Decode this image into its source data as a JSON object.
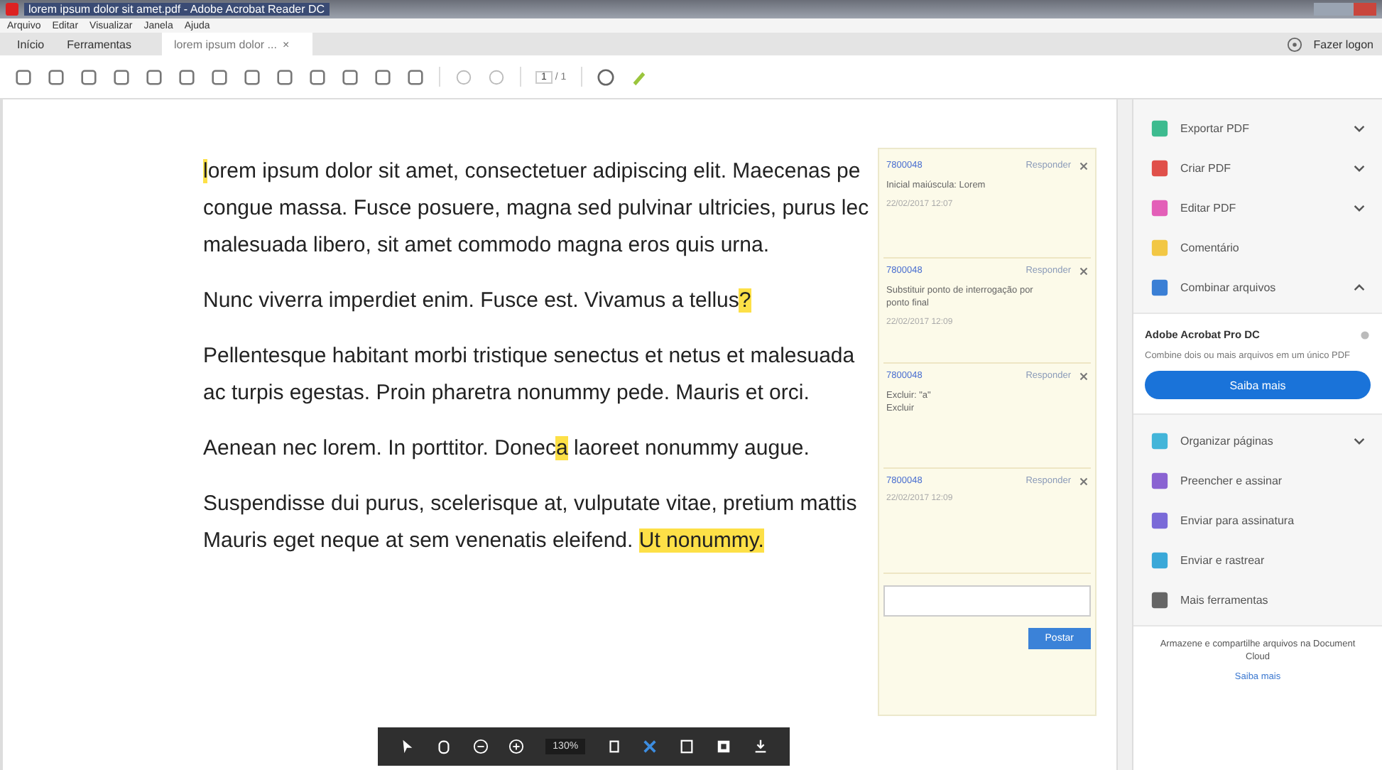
{
  "window": {
    "title": "lorem ipsum dolor sit amet.pdf - Adobe Acrobat Reader DC"
  },
  "menu": [
    "Arquivo",
    "Editar",
    "Visualizar",
    "Janela",
    "Ajuda"
  ],
  "tabs": [
    {
      "label": "Início",
      "selected": false
    },
    {
      "label": "Ferramentas",
      "selected": false
    },
    {
      "label": "lorem ipsum dolor ...",
      "selected": true
    }
  ],
  "tab_close": "×",
  "sign_in": "Fazer logon",
  "toolbar": {
    "page": "1",
    "pages": "/ 1"
  },
  "document": {
    "paragraphs": [
      [
        [
          {
            "text": "l",
            "highlight": true
          },
          {
            "text": "orem ipsum dolor sit amet, consectetuer adipiscing elit. Maecenas pe",
            "highlight": false
          }
        ],
        [
          {
            "text": "congue massa. Fusce posuere, magna sed pulvinar ultricies, purus lec",
            "highlight": false
          }
        ],
        [
          {
            "text": "malesuada libero, sit amet commodo magna eros quis urna.",
            "highlight": false
          }
        ]
      ],
      [
        [
          {
            "text": "Nunc viverra imperdiet enim. Fusce est. Vivamus a tellus",
            "highlight": false
          },
          {
            "text": "?",
            "highlight": true
          }
        ]
      ],
      [
        [
          {
            "text": "Pellentesque habitant morbi tristique senectus et netus et malesuada",
            "highlight": false
          }
        ],
        [
          {
            "text": "ac turpis egestas. Proin pharetra nonummy pede. Mauris et orci.",
            "highlight": false
          }
        ]
      ],
      [
        [
          {
            "text": "Aenean nec lorem. In porttitor. Donec",
            "highlight": false
          },
          {
            "text": "a",
            "highlight": true
          },
          {
            "text": " laoreet nonummy augue.",
            "highlight": false
          }
        ]
      ],
      [
        [
          {
            "text": "Suspendisse dui purus, scelerisque at, vulputate vitae, pretium mattis",
            "highlight": false
          }
        ],
        [
          {
            "text": "Mauris eget neque at sem venenatis eleifend. ",
            "highlight": false
          },
          {
            "text": "Ut nonummy.",
            "highlight": true
          }
        ]
      ]
    ]
  },
  "comments": [
    {
      "author": "7800048",
      "reply": "Responder",
      "body": [
        "Inicial maiúscula: Lorem"
      ],
      "date": "22/02/2017 12:07"
    },
    {
      "author": "7800048",
      "reply": "Responder",
      "body": [
        "Substituir ponto de interrogação por",
        "ponto final"
      ],
      "date": "22/02/2017 12:09"
    },
    {
      "author": "7800048",
      "reply": "Responder",
      "body": [
        "Excluir: \"a\"",
        "Excluir"
      ]
    },
    {
      "author": "7800048",
      "reply": "Responder",
      "date": "22/02/2017 12:09"
    }
  ],
  "post_button": "Postar",
  "tools": [
    {
      "kind": "expandable",
      "label": "Exportar PDF",
      "color": "#3dbb8f",
      "expanded": false
    },
    {
      "kind": "expandable",
      "label": "Criar PDF",
      "color": "#e0504a",
      "expanded": false
    },
    {
      "kind": "expandable",
      "label": "Editar PDF",
      "color": "#e35fb8",
      "expanded": false
    },
    {
      "kind": "plain",
      "label": "Comentário",
      "color": "#f2c744"
    },
    {
      "kind": "expandable",
      "label": "Combinar arquivos",
      "color": "#3a7fd5",
      "expanded": true
    }
  ],
  "promo": {
    "title": "Adobe Acrobat Pro DC",
    "text": "Combine dois ou mais arquivos em um único PDF",
    "button": "Saiba mais"
  },
  "more_tools": [
    {
      "kind": "expandable",
      "label": "Organizar páginas",
      "color": "#43b5d9",
      "expanded": false
    },
    {
      "kind": "plain",
      "label": "Preencher e assinar",
      "color": "#8a63d2"
    },
    {
      "kind": "plain",
      "label": "Enviar para assinatura",
      "color": "#7a6ad8"
    },
    {
      "kind": "plain",
      "label": "Enviar e rastrear",
      "color": "#3aa8d8"
    },
    {
      "kind": "plain",
      "label": "Mais ferramentas",
      "color": "#666666"
    }
  ],
  "cloud": {
    "text": "Armazene e compartilhe arquivos na Document Cloud",
    "link": "Saiba mais"
  },
  "float_bar": {
    "zoom": "130%"
  }
}
